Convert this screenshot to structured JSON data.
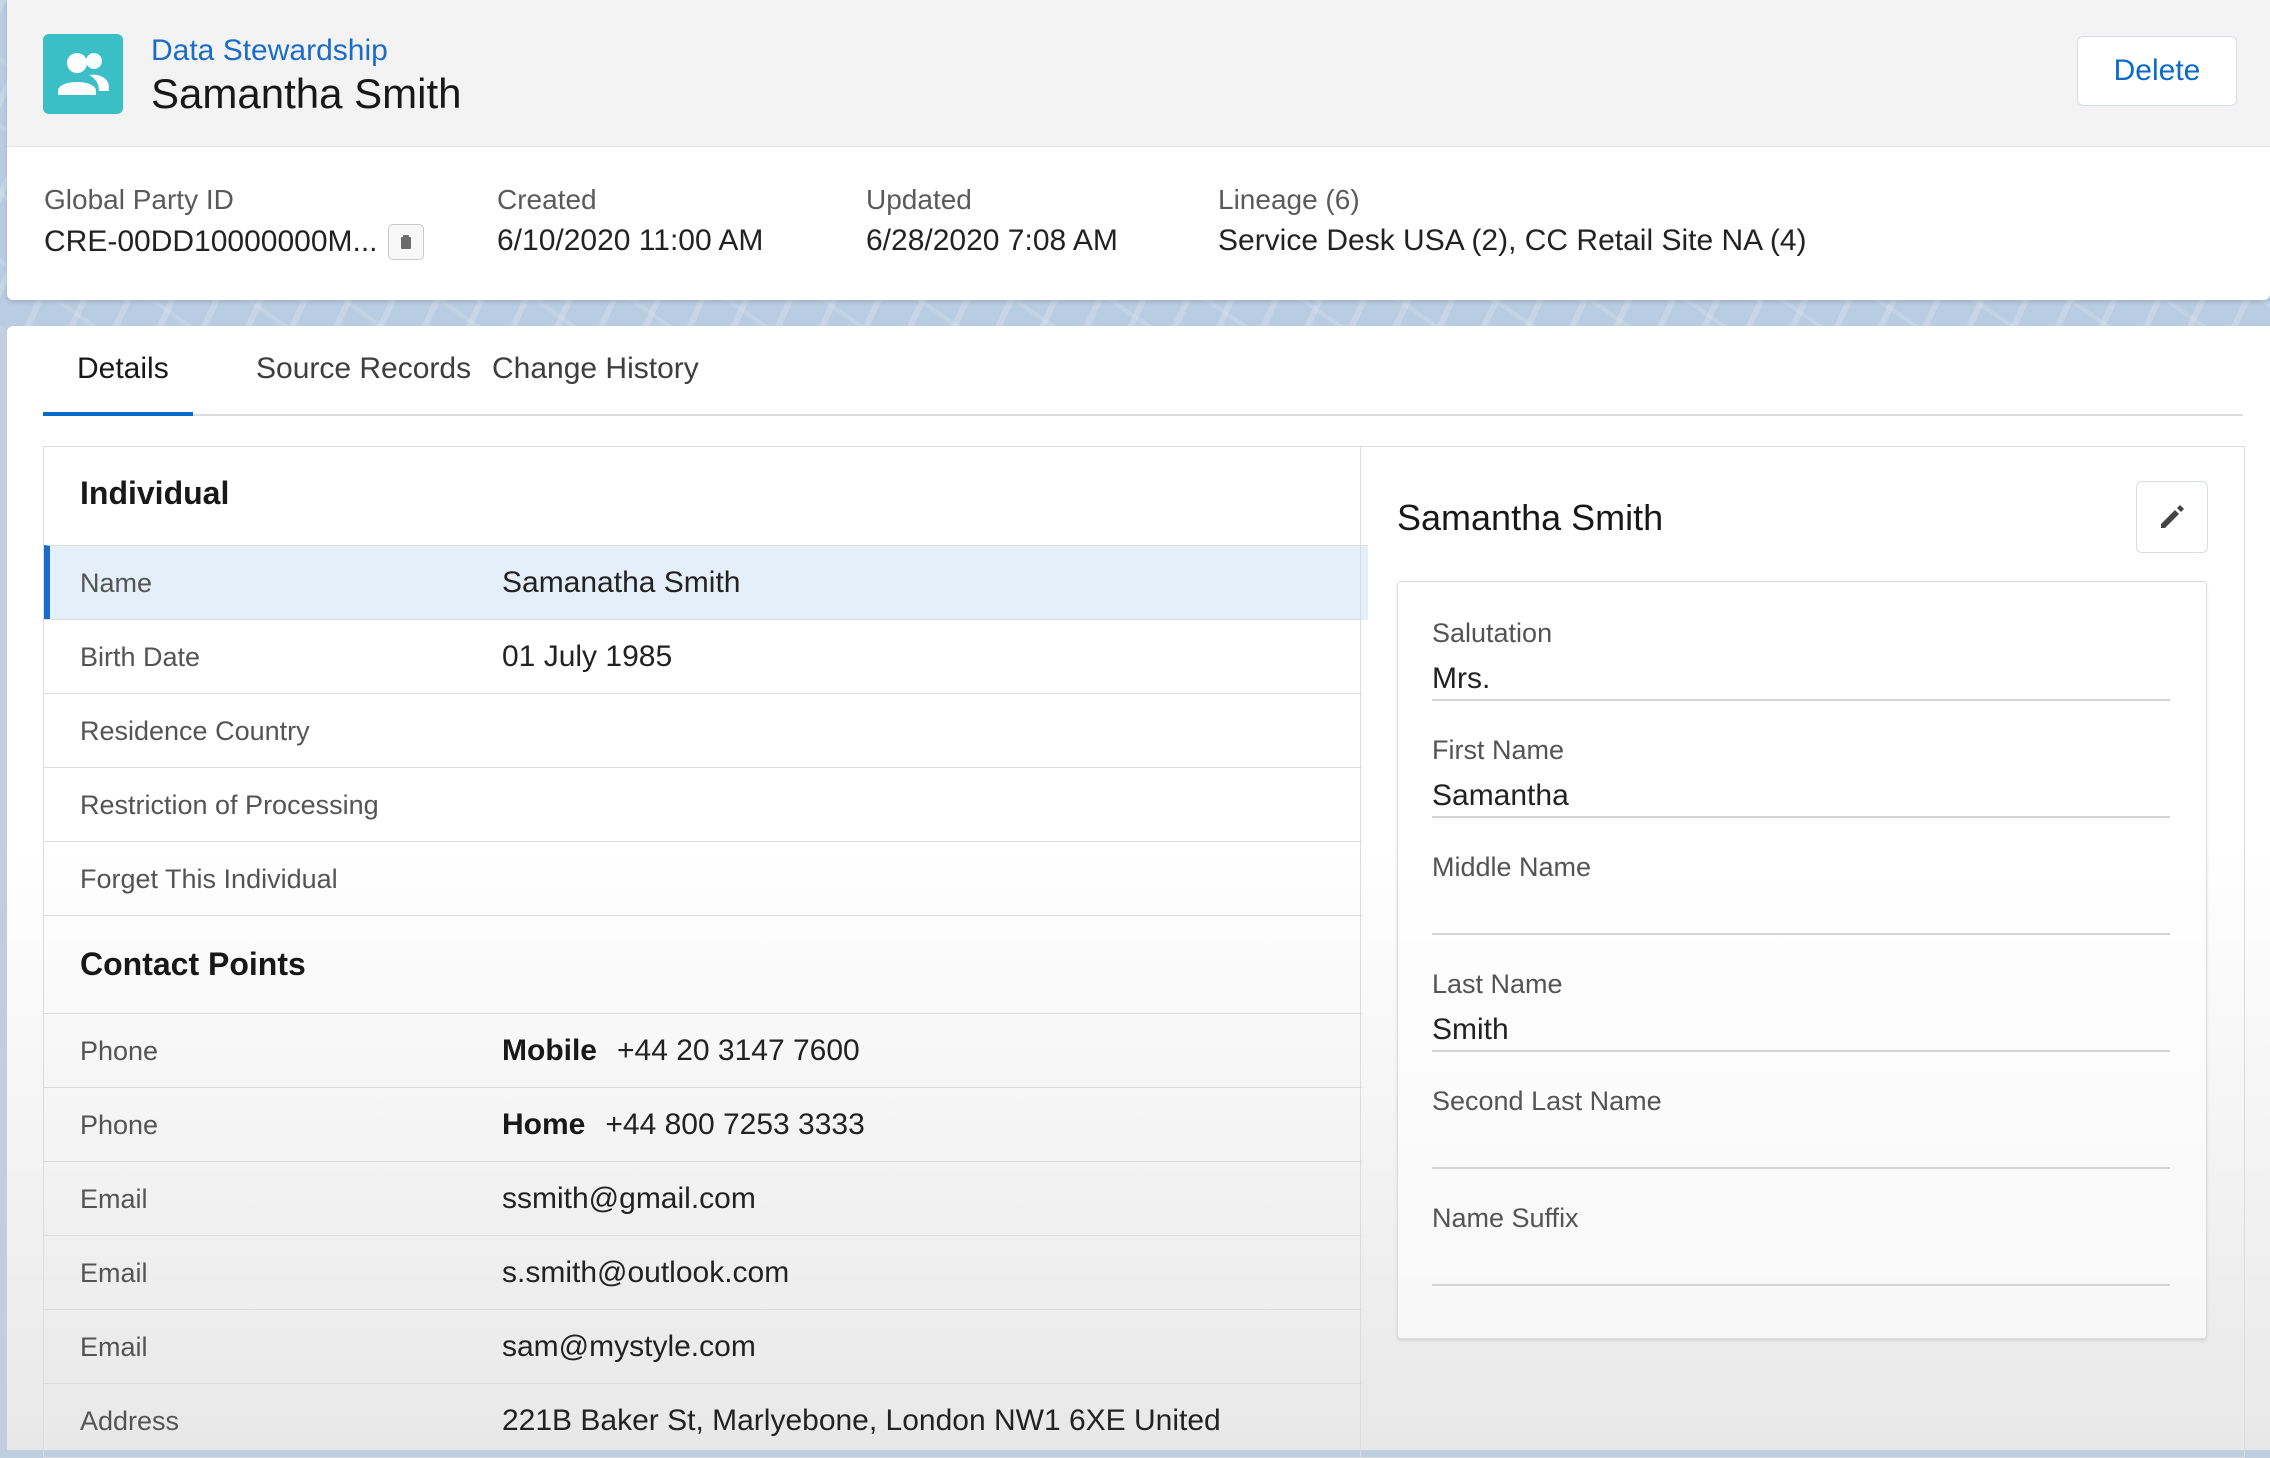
{
  "header": {
    "record_type": "Data Stewardship",
    "title": "Samantha Smith",
    "delete_label": "Delete",
    "meta": [
      {
        "label": "Global Party ID",
        "value": "CRE-00DD10000000M..."
      },
      {
        "label": "Created",
        "value": "6/10/2020 11:00 AM"
      },
      {
        "label": "Updated",
        "value": "6/28/2020 7:08 AM"
      },
      {
        "label": "Lineage (6)",
        "value": "Service Desk USA (2), CC Retail Site NA (4)"
      }
    ]
  },
  "tabs": [
    {
      "label": "Details",
      "active": true
    },
    {
      "label": "Source Records",
      "active": false
    },
    {
      "label": "Change History",
      "active": false
    }
  ],
  "individual": {
    "heading": "Individual",
    "rows": [
      {
        "label": "Name",
        "value": "Samanatha Smith"
      },
      {
        "label": "Birth Date",
        "value": "01 July 1985"
      },
      {
        "label": "Residence Country",
        "value": ""
      },
      {
        "label": "Restriction of Processing",
        "value": ""
      },
      {
        "label": "Forget This Individual",
        "value": ""
      }
    ]
  },
  "contact_points": {
    "heading": "Contact Points",
    "rows": [
      {
        "label": "Phone",
        "type": "Mobile",
        "value": "+44 20 3147 7600"
      },
      {
        "label": "Phone",
        "type": "Home",
        "value": "+44 800 7253 3333"
      },
      {
        "label": "Email",
        "type": "",
        "value": "ssmith@gmail.com"
      },
      {
        "label": "Email",
        "type": "",
        "value": "s.smith@outlook.com"
      },
      {
        "label": "Email",
        "type": "",
        "value": "sam@mystyle.com"
      },
      {
        "label": "Address",
        "type": "",
        "value": "221B Baker St, Marlyebone, London NW1 6XE United"
      }
    ]
  },
  "detail_panel": {
    "title": "Samantha Smith",
    "fields": [
      {
        "label": "Salutation",
        "value": "Mrs."
      },
      {
        "label": "First Name",
        "value": "Samantha"
      },
      {
        "label": "Middle Name",
        "value": ""
      },
      {
        "label": "Last Name",
        "value": "Smith"
      },
      {
        "label": "Second Last Name",
        "value": ""
      },
      {
        "label": "Name Suffix",
        "value": ""
      }
    ]
  },
  "colors": {
    "brand_blue": "#0b6bcb",
    "icon_teal": "#3bbfc7",
    "selected_row": "#e5eff9"
  },
  "icons": [
    "contacts-icon",
    "copy-icon",
    "pencil-icon"
  ]
}
